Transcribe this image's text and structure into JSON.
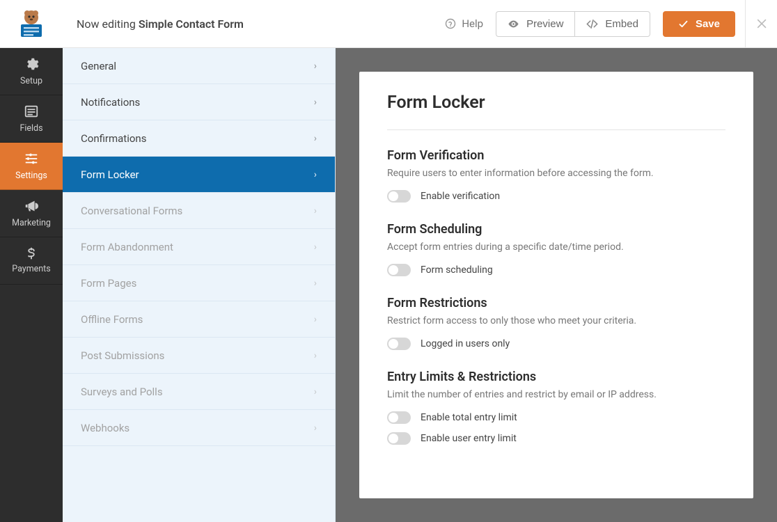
{
  "header": {
    "editing_prefix": "Now editing ",
    "form_name": "Simple Contact Form",
    "help_label": "Help",
    "preview_label": "Preview",
    "embed_label": "Embed",
    "save_label": "Save"
  },
  "rail": {
    "items": [
      {
        "label": "Setup"
      },
      {
        "label": "Fields"
      },
      {
        "label": "Settings"
      },
      {
        "label": "Marketing"
      },
      {
        "label": "Payments"
      }
    ]
  },
  "subpanel": {
    "items": [
      {
        "label": "General"
      },
      {
        "label": "Notifications"
      },
      {
        "label": "Confirmations"
      },
      {
        "label": "Form Locker"
      },
      {
        "label": "Conversational Forms"
      },
      {
        "label": "Form Abandonment"
      },
      {
        "label": "Form Pages"
      },
      {
        "label": "Offline Forms"
      },
      {
        "label": "Post Submissions"
      },
      {
        "label": "Surveys and Polls"
      },
      {
        "label": "Webhooks"
      }
    ]
  },
  "content": {
    "title": "Form Locker",
    "sections": [
      {
        "heading": "Form Verification",
        "description": "Require users to enter information before accessing the form.",
        "toggles": [
          {
            "label": "Enable verification"
          }
        ]
      },
      {
        "heading": "Form Scheduling",
        "description": "Accept form entries during a specific date/time period.",
        "toggles": [
          {
            "label": "Form scheduling"
          }
        ]
      },
      {
        "heading": "Form Restrictions",
        "description": "Restrict form access to only those who meet your criteria.",
        "toggles": [
          {
            "label": "Logged in users only"
          }
        ]
      },
      {
        "heading": "Entry Limits & Restrictions",
        "description": "Limit the number of entries and restrict by email or IP address.",
        "toggles": [
          {
            "label": "Enable total entry limit"
          },
          {
            "label": "Enable user entry limit"
          }
        ]
      }
    ]
  }
}
